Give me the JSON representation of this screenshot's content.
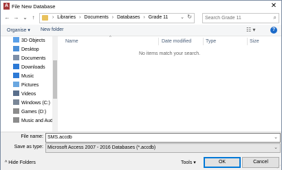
{
  "window": {
    "title": "File New Database",
    "app_icon": "A"
  },
  "address": {
    "crumbs": [
      "Libraries",
      "Documents",
      "Databases",
      "Grade 11"
    ],
    "separator": "›"
  },
  "search": {
    "placeholder": "Search Grade 11"
  },
  "toolbar": {
    "organise": "Organise ▾",
    "new_folder": "New folder"
  },
  "nav": {
    "items": [
      {
        "label": "3D Objects",
        "icon": "cube-icon",
        "color": "#5aa0e8"
      },
      {
        "label": "Desktop",
        "icon": "desktop-icon",
        "color": "#4a8fd8"
      },
      {
        "label": "Documents",
        "icon": "documents-icon",
        "color": "#7d8fa8"
      },
      {
        "label": "Downloads",
        "icon": "downloads-icon",
        "color": "#2d7ad6"
      },
      {
        "label": "Music",
        "icon": "music-icon",
        "color": "#2d7ad6"
      },
      {
        "label": "Pictures",
        "icon": "pictures-icon",
        "color": "#6aa7e0"
      },
      {
        "label": "Videos",
        "icon": "videos-icon",
        "color": "#5a6f8c"
      },
      {
        "label": "Windows (C:)",
        "icon": "drive-icon",
        "color": "#7a8797"
      },
      {
        "label": "Games (D:)",
        "icon": "drive-icon",
        "color": "#8c8c8c"
      },
      {
        "label": "Music and Aud",
        "icon": "drive-icon",
        "color": "#8c8c8c"
      }
    ]
  },
  "columns": {
    "name": "Name",
    "date_modified": "Date modified",
    "type": "Type",
    "size": "Size"
  },
  "empty_message": "No items match your search.",
  "form": {
    "file_name_label": "File name:",
    "file_name_value": "SMS.accdb",
    "save_as_type_label": "Save as type:",
    "save_as_type_value": "Microsoft Access 2007 - 2016 Databases (*.accdb)"
  },
  "footer": {
    "hide_folders": "Hide Folders",
    "tools": "Tools",
    "ok": "OK",
    "cancel": "Cancel"
  },
  "colors": {
    "accent": "#0078d7",
    "app_icon": "#a4373a",
    "folder": "#e8c15c"
  }
}
